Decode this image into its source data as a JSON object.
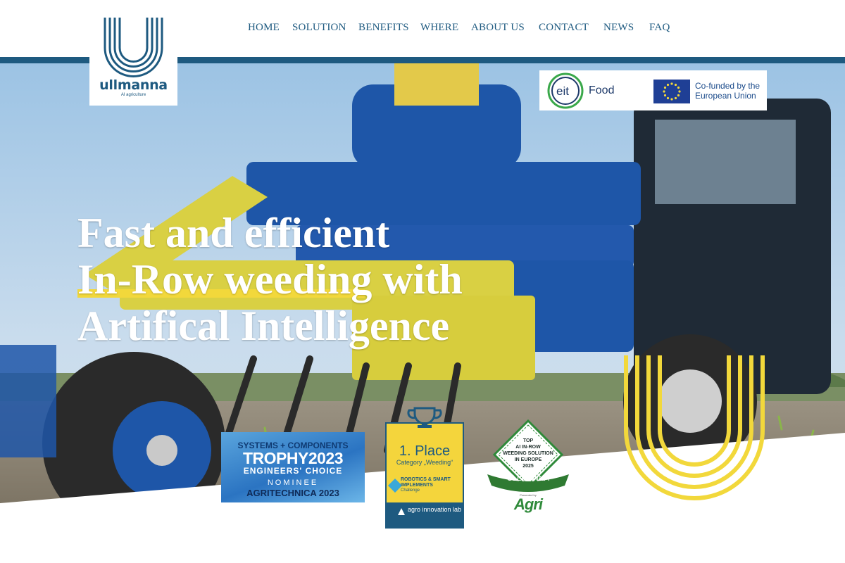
{
  "brand": {
    "name": "ullmanna",
    "tagline": "AI agriculture",
    "colors": {
      "blue": "#1e5a80",
      "yellow": "#f2d83b",
      "white": "#ffffff"
    }
  },
  "nav": {
    "items": [
      {
        "label": "HOME"
      },
      {
        "label": "SOLUTION"
      },
      {
        "label": "BENEFITS"
      },
      {
        "label": "WHERE"
      },
      {
        "label": "ABOUT US"
      },
      {
        "label": "CONTACT"
      },
      {
        "label": "NEWS"
      },
      {
        "label": "FAQ"
      }
    ]
  },
  "funding": {
    "eit_mark": "eit",
    "eit_word": "Food",
    "eu_flag_icon": "eu-flag-icon",
    "eu_text": "Co-funded by the European Union"
  },
  "hero": {
    "line1": "Fast and efficient",
    "line2": "In-Row weeding with",
    "line3": "Artifical Intelligence",
    "image": "tractor-weeding-implement-photo"
  },
  "awards": {
    "trophy": {
      "line1": "SYSTEMS + COMPONENTS",
      "line2": "TROPHY2023",
      "line3": "ENGINEERS' CHOICE",
      "line4": "NOMINEE",
      "line5": "AGRITECHNICA 2023"
    },
    "place": {
      "title": "1. Place",
      "category": "Category „Weeding“",
      "robotics": "ROBOTICS & SMART IMPLEMENTS",
      "challenge": "Challenge",
      "org": "agro innovation lab"
    },
    "top": {
      "line1": "TOP",
      "line2": "AI IN-ROW",
      "line3": "WEEDING SOLUTION",
      "line4": "IN EUROPE",
      "line5": "2025",
      "ribbon": "ULLMANNA",
      "presented_by": "Presented by",
      "publisher": "Agri"
    }
  }
}
